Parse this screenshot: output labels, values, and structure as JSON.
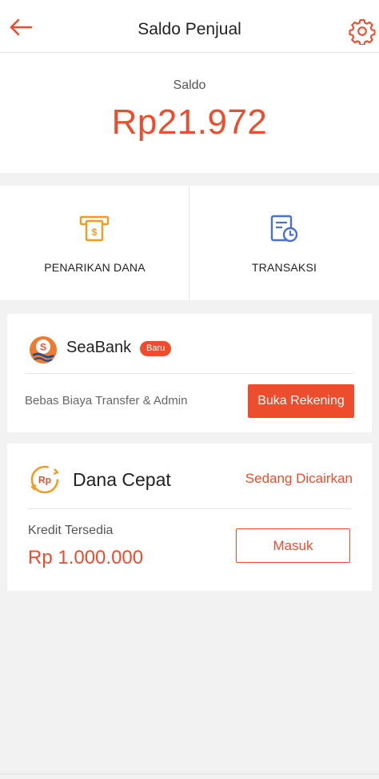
{
  "header": {
    "title": "Saldo Penjual",
    "back_icon": "arrow-left-icon",
    "settings_icon": "gear-icon"
  },
  "balance": {
    "label": "Saldo",
    "amount": "Rp21.972"
  },
  "actions": [
    {
      "label": "PENARIKAN DANA",
      "icon": "atm-withdraw-icon"
    },
    {
      "label": "TRANSAKSI",
      "icon": "transaction-history-icon"
    }
  ],
  "seabank": {
    "name": "SeaBank",
    "badge": "Baru",
    "description": "Bebas Biaya Transfer & Admin",
    "button_label": "Buka Rekening",
    "logo_icon": "seabank-logo"
  },
  "dana_cepat": {
    "name": "Dana Cepat",
    "status": "Sedang Dicairkan",
    "credit_label": "Kredit Tersedia",
    "credit_amount": "Rp 1.000.000",
    "button_label": "Masuk",
    "logo_icon": "rp-cycle-icon"
  },
  "colors": {
    "accent": "#ee4d2d",
    "blue": "#4a6fd6",
    "orange": "#f59b22"
  }
}
